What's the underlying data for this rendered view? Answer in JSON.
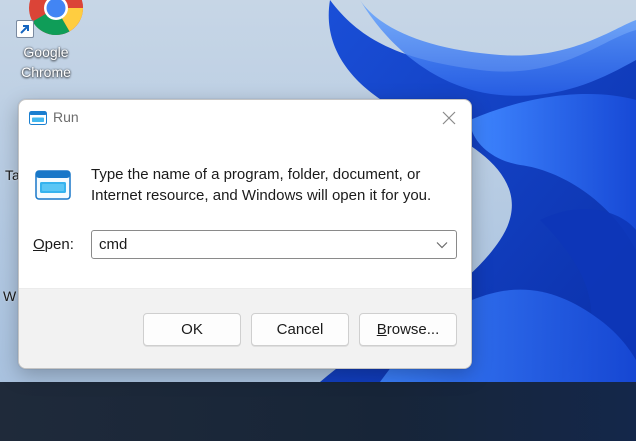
{
  "desktop": {
    "icons": [
      {
        "label_line1": "Google",
        "label_line2": "Chrome",
        "icon": "chrome-icon"
      }
    ],
    "peek_texts": [
      {
        "text": "Ta"
      },
      {
        "text": "W"
      }
    ],
    "colors": {
      "wallpaper_bloom": "#1e5ae8",
      "taskbar": "#1a2638"
    }
  },
  "dialog": {
    "title": "Run",
    "title_icon": "run-icon",
    "close_icon": "close-icon",
    "description": "Type the name of a program, folder, document, or Internet resource, and Windows will open it for you.",
    "open_label": {
      "accel": "O",
      "rest": "pen:"
    },
    "open_field": {
      "value": "cmd",
      "dropdown_icon": "chevron-down-icon"
    },
    "buttons": {
      "ok": "OK",
      "cancel": "Cancel",
      "browse_accel": "B",
      "browse_rest": "rowse..."
    }
  }
}
